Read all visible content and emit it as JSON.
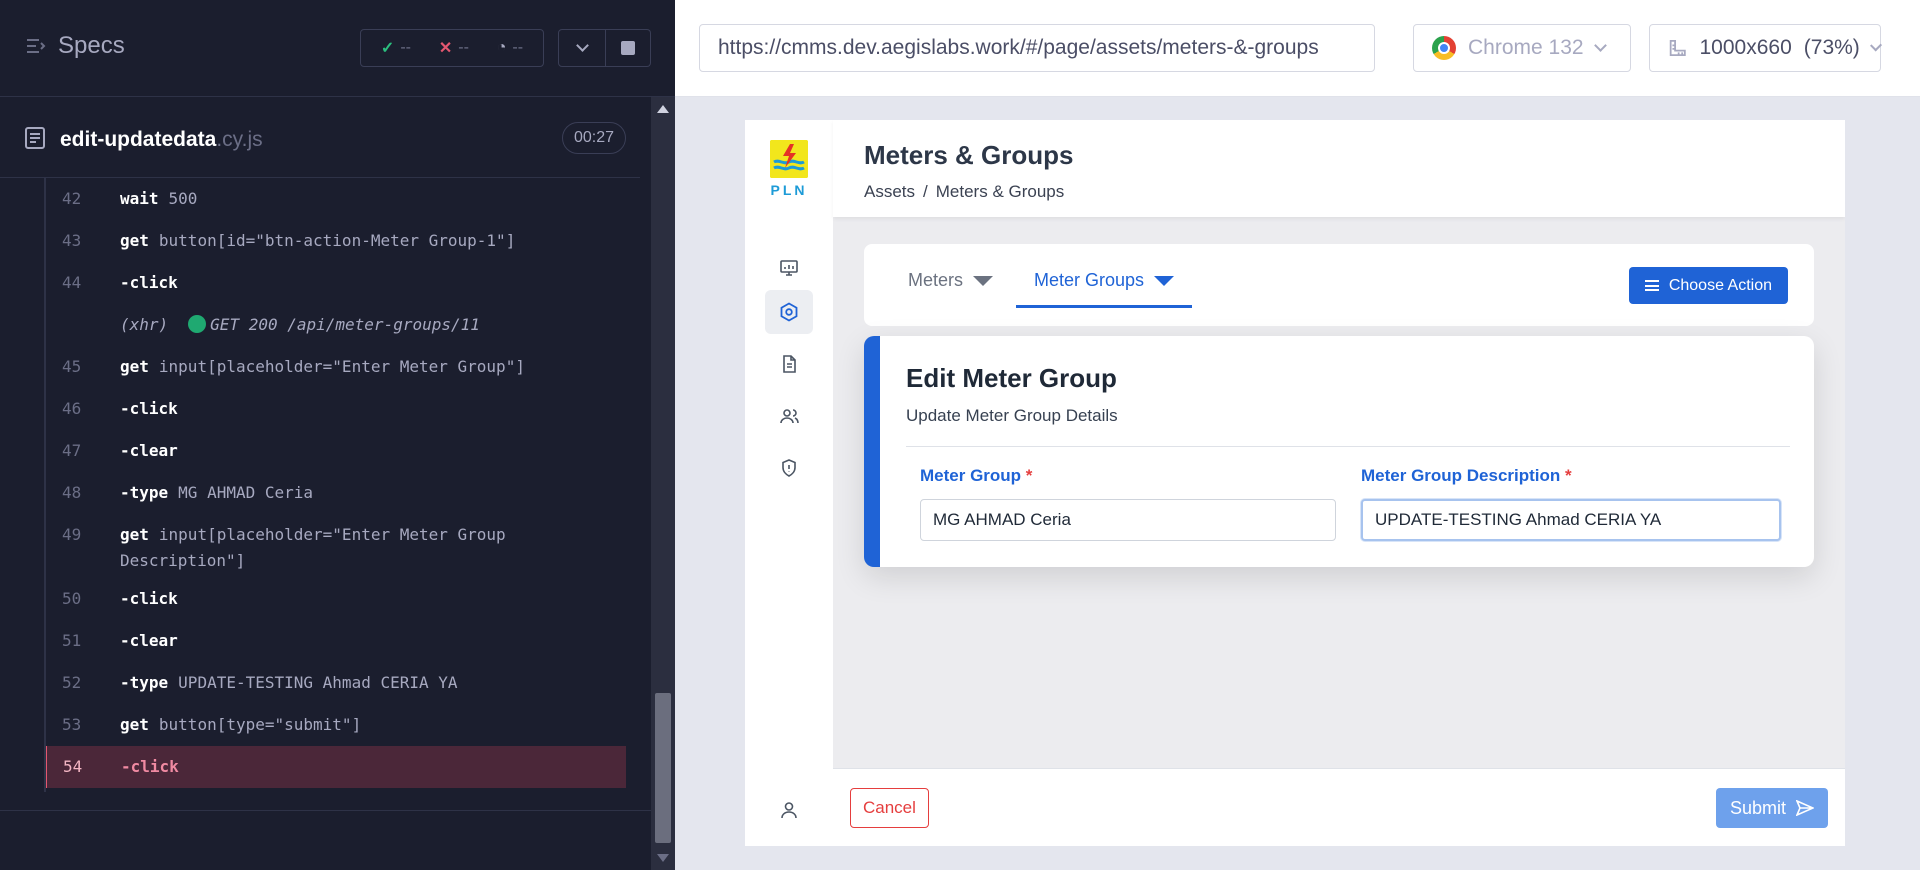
{
  "runner": {
    "title": "Specs",
    "stats": {
      "passed": "--",
      "failed": "--",
      "pending": "--"
    },
    "spec_name": "edit-updatedata",
    "spec_ext": ".cy.js",
    "duration": "00:27",
    "commands": [
      {
        "line": "42",
        "name": "wait",
        "arg": "500"
      },
      {
        "line": "43",
        "name": "get",
        "arg": "button[id=\"btn-action-Meter Group-1\"]"
      },
      {
        "line": "44",
        "name": "-click",
        "arg": ""
      },
      {
        "line": "",
        "xhr": "(xhr)",
        "arg": "GET 200 /api/meter-groups/11"
      },
      {
        "line": "45",
        "name": "get",
        "arg": "input[placeholder=\"Enter Meter Group\"]"
      },
      {
        "line": "46",
        "name": "-click",
        "arg": ""
      },
      {
        "line": "47",
        "name": "-clear",
        "arg": ""
      },
      {
        "line": "48",
        "name": "-type",
        "arg": "MG AHMAD Ceria"
      },
      {
        "line": "49",
        "name": "get",
        "arg": "input[placeholder=\"Enter Meter Group Description\"]"
      },
      {
        "line": "50",
        "name": "-click",
        "arg": ""
      },
      {
        "line": "51",
        "name": "-clear",
        "arg": ""
      },
      {
        "line": "52",
        "name": "-type",
        "arg": "UPDATE-TESTING Ahmad CERIA YA"
      },
      {
        "line": "53",
        "name": "get",
        "arg": "button[type=\"submit\"]"
      },
      {
        "line": "54",
        "name": "-click",
        "arg": "",
        "active": true
      }
    ]
  },
  "browser": {
    "url": "https://cmms.dev.aegislabs.work/#/page/assets/meters-&-groups",
    "name": "Chrome 132",
    "viewport": "1000x660",
    "zoom": "(73%)"
  },
  "app": {
    "logo_text": "PLN",
    "page_title": "Meters & Groups",
    "breadcrumb": [
      "Assets",
      "/",
      "Meters & Groups"
    ],
    "tabs": [
      {
        "label": "Meters",
        "active": false
      },
      {
        "label": "Meter Groups",
        "active": true
      }
    ],
    "choose_action_label": "Choose Action",
    "edit": {
      "title": "Edit Meter Group",
      "subtitle": "Update Meter Group Details",
      "meter_group_label": "Meter Group",
      "meter_group_value": "MG AHMAD Ceria",
      "meter_group_placeholder": "Enter Meter Group",
      "description_label": "Meter Group Description",
      "description_value": "UPDATE-TESTING Ahmad CERIA YA",
      "description_placeholder": "Enter Meter Group Description",
      "required_mark": "*"
    },
    "cancel_label": "Cancel",
    "submit_label": "Submit"
  },
  "colors": {
    "accent": "#1f63d6",
    "danger": "#e53e3e",
    "runner_bg": "#1b1e2e",
    "active_command_bg": "#4b2739"
  }
}
